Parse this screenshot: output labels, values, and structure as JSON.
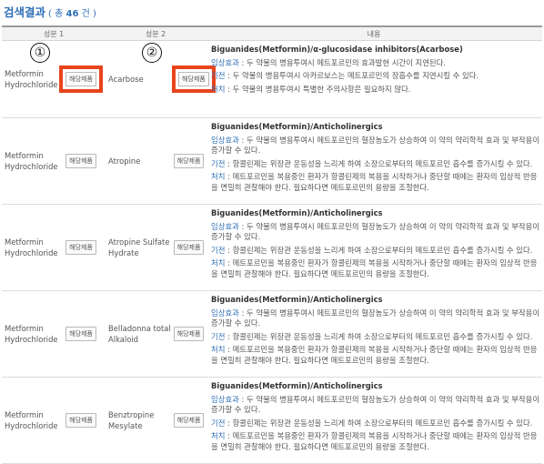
{
  "page": {
    "title": "검색결과",
    "count_prefix": "( 총",
    "count": "46",
    "count_suffix": "건 )"
  },
  "table": {
    "headers": [
      "성분 1",
      "성분 2",
      "내용"
    ],
    "button_label": "해당제품",
    "markers": [
      "①",
      "②"
    ],
    "rows": [
      {
        "drug1": "Metformin Hydrochloride",
        "drug2": "Acarbose",
        "title": "Biguanides(Metformin)/α-glucosidase inhibitors(Acarbose)",
        "items": [
          {
            "key": "임상효과",
            "text": " : 두 약물의 병용투여시 메트포르민의 효과발현 시간이 지연된다."
          },
          {
            "key": "기전",
            "text": " : 두 약물의 병용투여시 아카르보스는 메트포르민의 장흡수를 지연시킬 수 있다."
          },
          {
            "key": "처치",
            "text": " : 두 약물의 병용투여시 특별한 주의사항은 필요하지 않다."
          }
        ]
      },
      {
        "drug1": "Metformin Hydrochloride",
        "drug2": "Atropine",
        "title": "Biguanides(Metformin)/Anticholinergics",
        "items": [
          {
            "key": "임상효과",
            "text": " : 두 약물의 병용투여시 메트포르민의 혈장농도가 상승하여 이 약의 약리학적 효과 및 부작용이 증가할 수 있다."
          },
          {
            "key": "기전",
            "text": " : 항콜린제는 위장관 운동성을 느리게 하여 소장으로부터의 메트포르민 흡수를 증가시킬 수 있다."
          },
          {
            "key": "처치",
            "text": " : 메트포르민을 복용중인 환자가 항콜린제의 복용을 시작하거나 중단할 때에는 환자의 임상적 반응을 면밀히 관찰해야 한다. 필요하다면 메트포르민의 용량을 조절한다."
          }
        ]
      },
      {
        "drug1": "Metformin Hydrochloride",
        "drug2": "Atropine Sulfate Hydrate",
        "title": "Biguanides(Metformin)/Anticholinergics",
        "items": [
          {
            "key": "임상효과",
            "text": " : 두 약물의 병용투여시 메트포르민의 혈장농도가 상승하여 이 약의 약리학적 효과 및 부작용이 증가할 수 있다."
          },
          {
            "key": "기전",
            "text": " : 항콜린제는 위장관 운동성을 느리게 하여 소장으로부터의 메트포르민 흡수를 증가시킬 수 있다."
          },
          {
            "key": "처치",
            "text": " : 메트포르민을 복용중인 환자가 항콜린제의 복용을 시작하거나 중단할 때에는 환자의 임상적 반응을 면밀히 관찰해야 한다. 필요하다면 메트포르민의 용량을 조절한다."
          }
        ]
      },
      {
        "drug1": "Metformin Hydrochloride",
        "drug2": "Belladonna total Alkaloid",
        "title": "Biguanides(Metformin)/Anticholinergics",
        "items": [
          {
            "key": "임상효과",
            "text": " : 두 약물의 병용투여시 메트포르민의 혈장농도가 상승하여 이 약의 약리학적 효과 및 부작용이 증가할 수 있다."
          },
          {
            "key": "기전",
            "text": " : 항콜린제는 위장관 운동성을 느리게 하여 소장으로부터의 메트포르민 흡수를 증가시킬 수 있다."
          },
          {
            "key": "처치",
            "text": " : 메트포르민을 복용중인 환자가 항콜린제의 복용을 시작하거나 중단할 때에는 환자의 임상적 반응을 면밀히 관찰해야 한다. 필요하다면 메트포르민의 용량을 조절한다."
          }
        ]
      },
      {
        "drug1": "Metformin Hydrochloride",
        "drug2": "Benztropine Mesylate",
        "title": "Biguanides(Metformin)/Anticholinergics",
        "items": [
          {
            "key": "임상효과",
            "text": " : 두 약물의 병용투여시 메트포르민의 혈장농도가 상승하여 이 약의 약리학적 효과 및 부작용이 증가할 수 있다."
          },
          {
            "key": "기전",
            "text": " : 항콜린제는 위장관 운동성을 느리게 하여 소장으로부터의 메트포르민 흡수를 증가시킬 수 있다."
          },
          {
            "key": "처치",
            "text": " : 메트포르민을 복용중인 환자가 항콜린제의 복용을 시작하거나 중단할 때에는 환자의 임상적 반응을 면밀히 관찰해야 한다. 필요하다면 메트포르민의 용량을 조절한다."
          }
        ]
      }
    ]
  }
}
